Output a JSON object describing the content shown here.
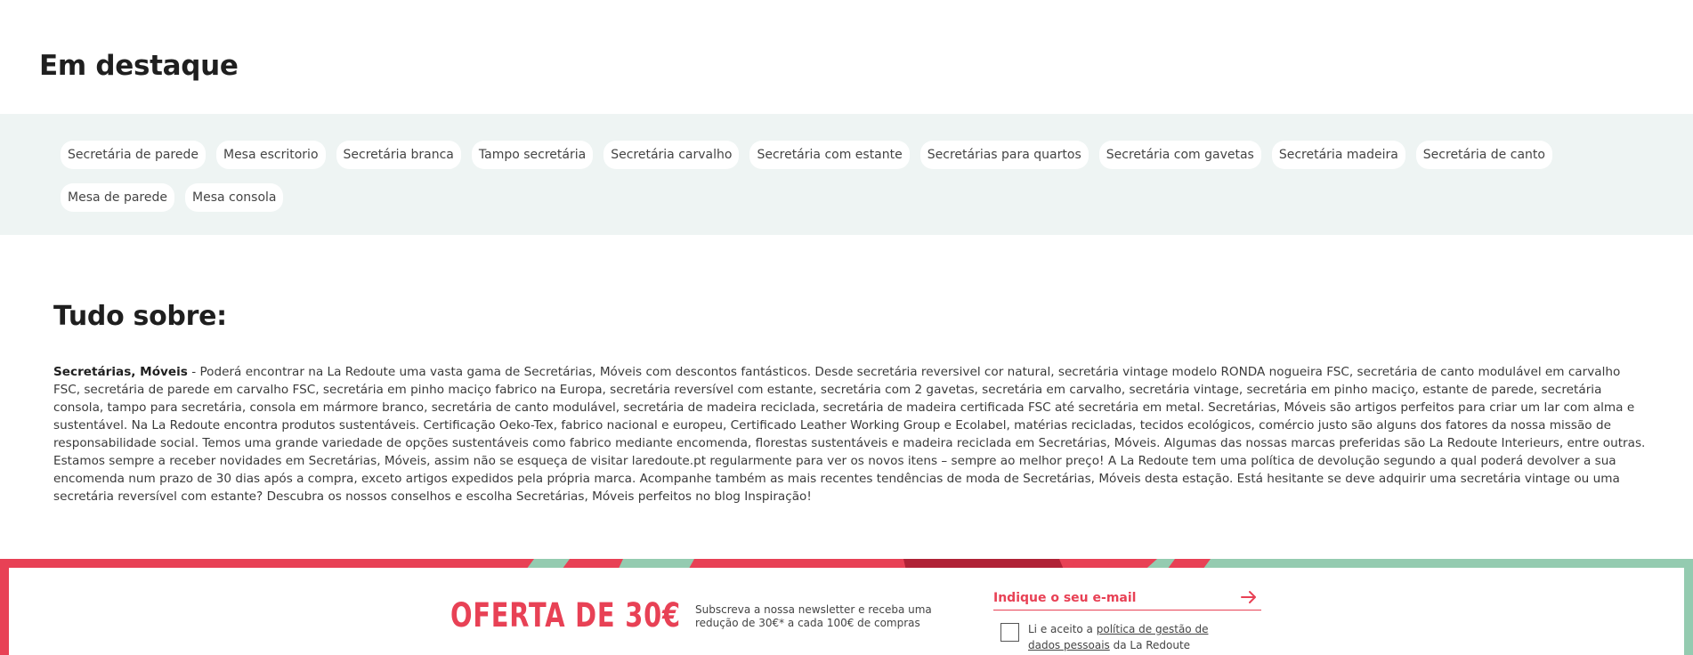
{
  "featured": {
    "title": "Em destaque",
    "chips": [
      "Secretária de parede",
      "Mesa escritorio",
      "Secretária branca",
      "Tampo secretária",
      "Secretária carvalho",
      "Secretária com estante",
      "Secretárias para quartos",
      "Secretária com gavetas",
      "Secretária madeira",
      "Secretária de canto",
      "Mesa de parede",
      "Mesa consola"
    ]
  },
  "about": {
    "title": "Tudo sobre:",
    "lead": "Secretárias, Móveis",
    "body": " - Poderá encontrar na La Redoute uma vasta gama de Secretárias, Móveis com descontos fantásticos. Desde secretária reversivel cor natural, secretária vintage modelo RONDA nogueira FSC, secretária de canto modulável em carvalho FSC, secretária de parede em carvalho FSC, secretária em pinho maciço fabrico na Europa, secretária reversível com estante, secretária com 2 gavetas, secretária em carvalho, secretária vintage, secretária em pinho maciço, estante de parede, secretária consola, tampo para secretária, consola em mármore branco, secretária de canto modulável, secretária de madeira reciclada, secretária de madeira certificada FSC até secretária em metal. Secretárias, Móveis são artigos perfeitos para criar um lar com alma e sustentável. Na La Redoute encontra produtos sustentáveis. Certificação Oeko-Tex, fabrico nacional e europeu, Certificado Leather Working Group e Ecolabel, matérias recicladas, tecidos ecológicos, comércio justo são alguns dos fatores da nossa missão de responsabilidade social. Temos uma grande variedade de opções sustentáveis como fabrico mediante encomenda, florestas sustentáveis e madeira reciclada em Secretárias, Móveis. Algumas das nossas marcas preferidas são La Redoute Interieurs, entre outras. Estamos sempre a receber novidades em Secretárias, Móveis, assim não se esqueça de visitar laredoute.pt regularmente para ver os novos itens – sempre ao melhor preço! A La Redoute tem uma política de devolução segundo a qual poderá devolver a sua encomenda num prazo de 30 dias após a compra, exceto artigos expedidos pela própria marca. Acompanhe também as mais recentes tendências de moda de Secretárias, Móveis desta estação. Está hesitante se deve adquirir uma secretária vintage ou uma secretária reversível com estante? Descubra os nossos conselhos e escolha Secretárias, Móveis perfeitos no blog Inspiração!"
  },
  "newsletter": {
    "offer": "OFERTA DE 30€",
    "description": "Subscreva a nossa newsletter e receba uma redução de 30€* a cada 100€ de compras",
    "email_placeholder": "Indique o seu e-mail",
    "submit_icon": "arrow-right-icon",
    "consent_prefix": "Li e aceito a ",
    "consent_link": "política de gestão de dados pessoais",
    "consent_suffix": " da La Redoute"
  },
  "colors": {
    "brand_red": "#e84155",
    "dark_red": "#b02236",
    "mint": "#94cbb0",
    "chip_band": "#eef4f3"
  }
}
